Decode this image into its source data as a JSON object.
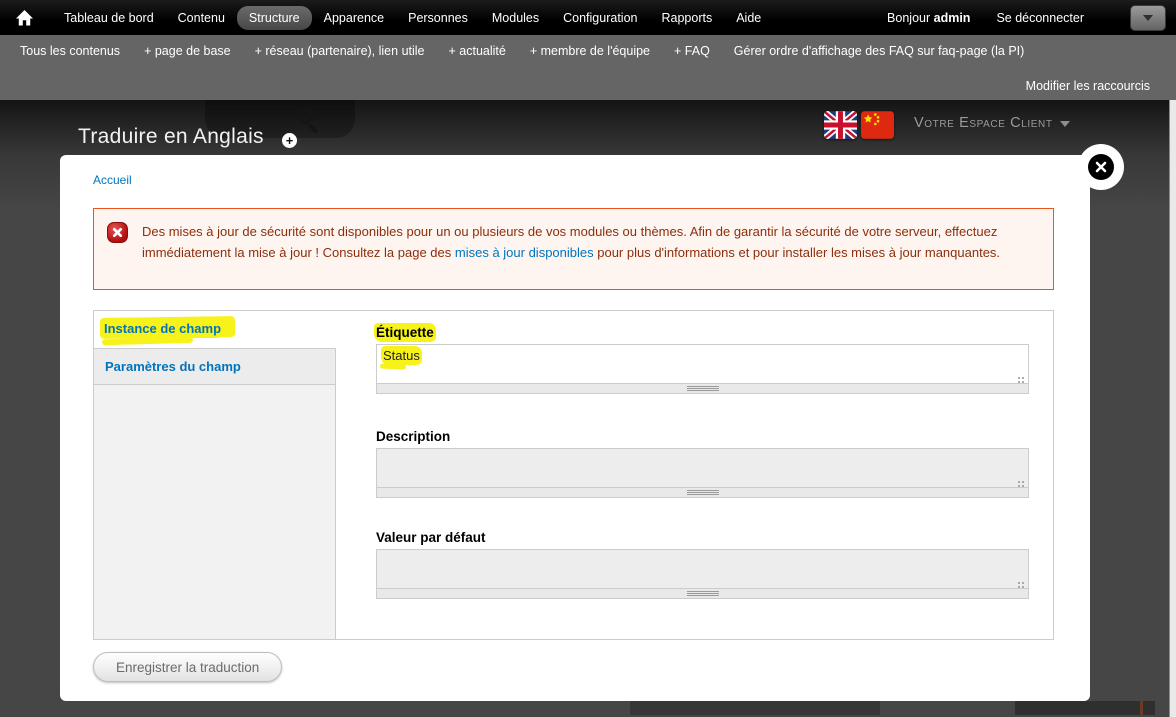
{
  "toolbar": {
    "items": [
      "Tableau de bord",
      "Contenu",
      "Structure",
      "Apparence",
      "Personnes",
      "Modules",
      "Configuration",
      "Rapports",
      "Aide"
    ],
    "active_item": "Structure",
    "greeting_prefix": "Bonjour",
    "username": "admin",
    "logout_label": "Se déconnecter"
  },
  "shortcuts": {
    "items": [
      "Tous les contenus",
      "+ page de base",
      "+ réseau (partenaire), lien utile",
      "+ actualité",
      "+ membre de l'équipe",
      "+ FAQ",
      "Gérer ordre d'affichage des FAQ sur faq-page (la PI)"
    ],
    "edit_label": "Modifier les raccourcis"
  },
  "page_header": {
    "title": "Traduire en Anglais",
    "client_menu_label": "Votre Espace Client",
    "flags": [
      "united-kingdom",
      "china"
    ]
  },
  "icons": {
    "home": "house",
    "search": "magnifier",
    "add": "plus-circle",
    "close": "x-in-black-circle",
    "error": "white-x-on-red-octagon",
    "toolbar_toggle": "chevron-down"
  },
  "overlay": {
    "breadcrumb": "Accueil",
    "error_message": {
      "text_before_link": "Des mises à jour de sécurité sont disponibles pour un ou plusieurs de vos modules ou thèmes. Afin de garantir la sécurité de votre serveur, effectuez immédiatement la mise à jour ! Consultez la page des ",
      "link_text": "mises à jour disponibles",
      "text_after_link": " pour plus d'informations et pour installer les mises à jour manquantes."
    },
    "vertical_tabs": [
      {
        "label": "Instance de champ",
        "active": true,
        "highlighted": true
      },
      {
        "label": "Paramètres du champ",
        "active": false,
        "highlighted": false
      }
    ],
    "form": {
      "fields": [
        {
          "label": "Étiquette",
          "value": "Status",
          "label_highlighted": true,
          "value_highlighted": true
        },
        {
          "label": "Description",
          "value": "",
          "label_highlighted": false,
          "value_highlighted": false
        },
        {
          "label": "Valeur par défaut",
          "value": "",
          "label_highlighted": false,
          "value_highlighted": false
        }
      ],
      "submit_label": "Enregistrer la traduction"
    }
  },
  "colors": {
    "toolbar_bg": "#000000",
    "shortcutbar_bg": "#656565",
    "page_dim_bg": "#464646",
    "link_blue": "#0074bd",
    "error_border": "#ed541d",
    "error_bg": "#fef5f1",
    "error_text": "#8c2e0b",
    "highlight_yellow": "#f7f219"
  }
}
